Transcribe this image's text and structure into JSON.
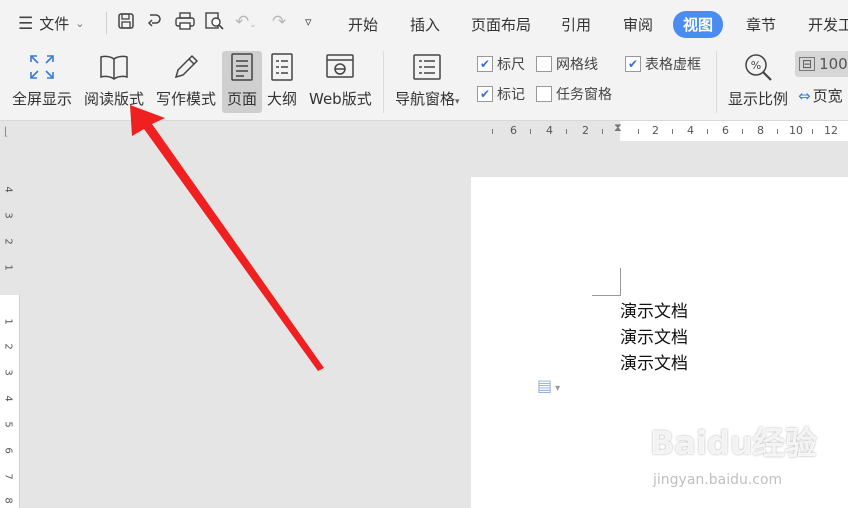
{
  "menubar": {
    "file_label": "文件",
    "tabs": [
      "开始",
      "插入",
      "页面布局",
      "引用",
      "审阅",
      "视图",
      "章节",
      "开发工"
    ],
    "active_tab": "视图"
  },
  "ribbon": {
    "buttons": [
      "全屏显示",
      "阅读版式",
      "写作模式",
      "页面",
      "大纲",
      "Web版式"
    ],
    "nav_pane": "导航窗格",
    "checkboxes": {
      "ruler": "标尺",
      "gridlines": "网格线",
      "table_borders": "表格虚框",
      "marks": "标记",
      "task_pane": "任务窗格"
    },
    "zoom_label": "显示比例",
    "zoom_value": "100",
    "page_width": "页宽"
  },
  "ruler": {
    "h_numbers": [
      "6",
      "4",
      "2",
      "2",
      "4",
      "6",
      "8",
      "10",
      "12"
    ],
    "v_numbers": [
      "4",
      "3",
      "2",
      "1",
      "1",
      "2",
      "3",
      "4",
      "5",
      "6",
      "7",
      "8"
    ]
  },
  "document": {
    "lines": [
      "演示文档",
      "演示文档",
      "演示文档"
    ]
  },
  "watermark": {
    "brand": "Baidu经验",
    "url": "jingyan.baidu.com"
  },
  "colors": {
    "active_tab": "#4a8cf0",
    "arrow": "#f02020",
    "ribbon_bg": "#f3f3f3",
    "canvas_bg": "#e5e5e5"
  }
}
